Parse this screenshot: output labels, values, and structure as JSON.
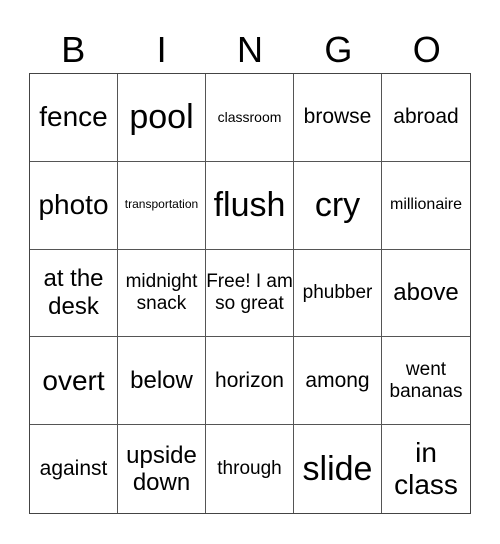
{
  "header": [
    "B",
    "I",
    "N",
    "G",
    "O"
  ],
  "cells": [
    "fence",
    "pool",
    "classroom",
    "browse",
    "abroad",
    "photo",
    "transportation",
    "flush",
    "cry",
    "millionaire",
    "at the desk",
    "midnight snack",
    "Free! I am so great",
    "phubber",
    "above",
    "overt",
    "below",
    "horizon",
    "among",
    "went bananas",
    "against",
    "upside down",
    "through",
    "slide",
    "in class"
  ]
}
